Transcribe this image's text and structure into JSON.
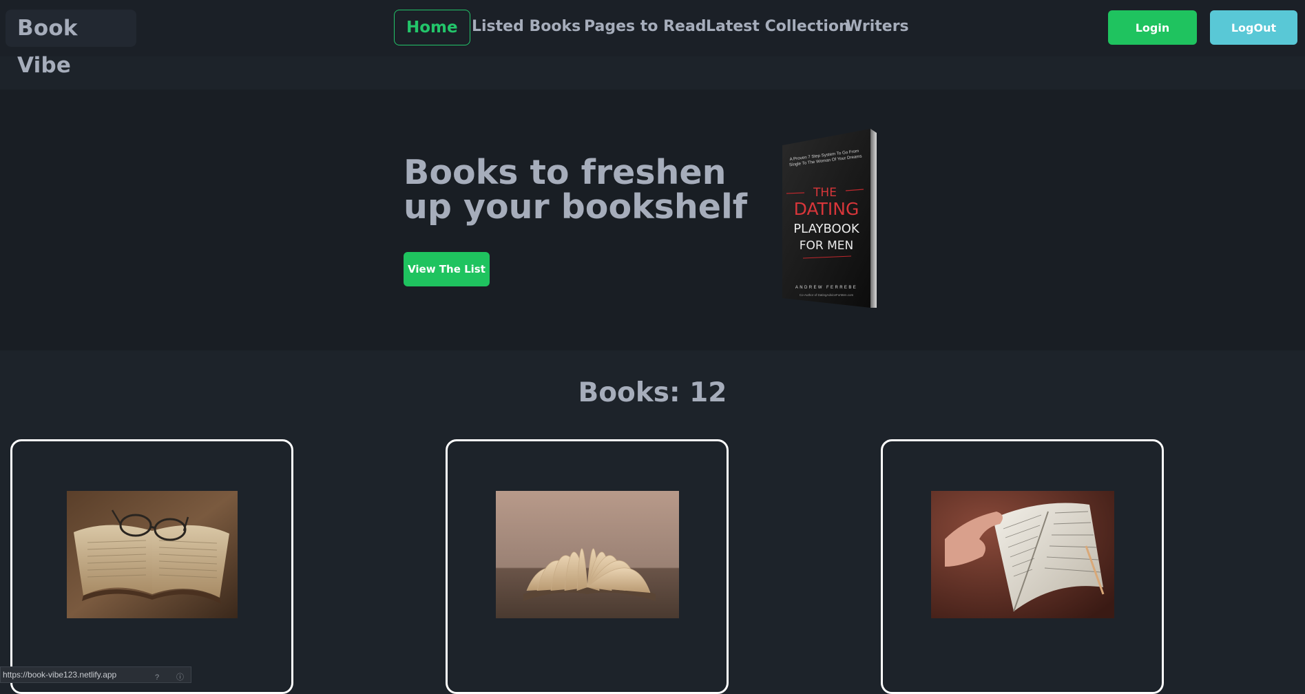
{
  "navbar": {
    "brand": "Book Vibe",
    "links": [
      {
        "label": "Home",
        "active": true
      },
      {
        "label": "Listed Books",
        "active": false
      },
      {
        "label": "Pages to Read",
        "active": false
      },
      {
        "label": "Latest Collection",
        "active": false
      },
      {
        "label": "Writers",
        "active": false
      }
    ],
    "login_label": "Login",
    "logout_label": "LogOut"
  },
  "hero": {
    "title": "Books to freshen up your bookshelf",
    "button_label": "View The List",
    "cover": {
      "tagline": "A Proven 7 Step System To Go From Single To The Woman Of Your Dreams",
      "title_the": "THE",
      "title_dating": "DATING",
      "title_playbook": "PLAYBOOK",
      "title_formen": "FOR MEN",
      "author": "ANDREW FERREBE",
      "author_site": "Co-Author of DatingAdviceForMen.com"
    }
  },
  "books": {
    "heading": "Books: 12",
    "cards": [
      {
        "image": "open-book-with-glasses"
      },
      {
        "image": "open-book-fanned-pages"
      },
      {
        "image": "hand-holding-open-book"
      }
    ]
  },
  "status_bar": {
    "url": "https://book-vibe123.netlify.app"
  },
  "colors": {
    "background": "#1d232a",
    "accent_green": "#1fc35f",
    "accent_cyan": "#59c8d6",
    "text": "#a6adbb"
  }
}
